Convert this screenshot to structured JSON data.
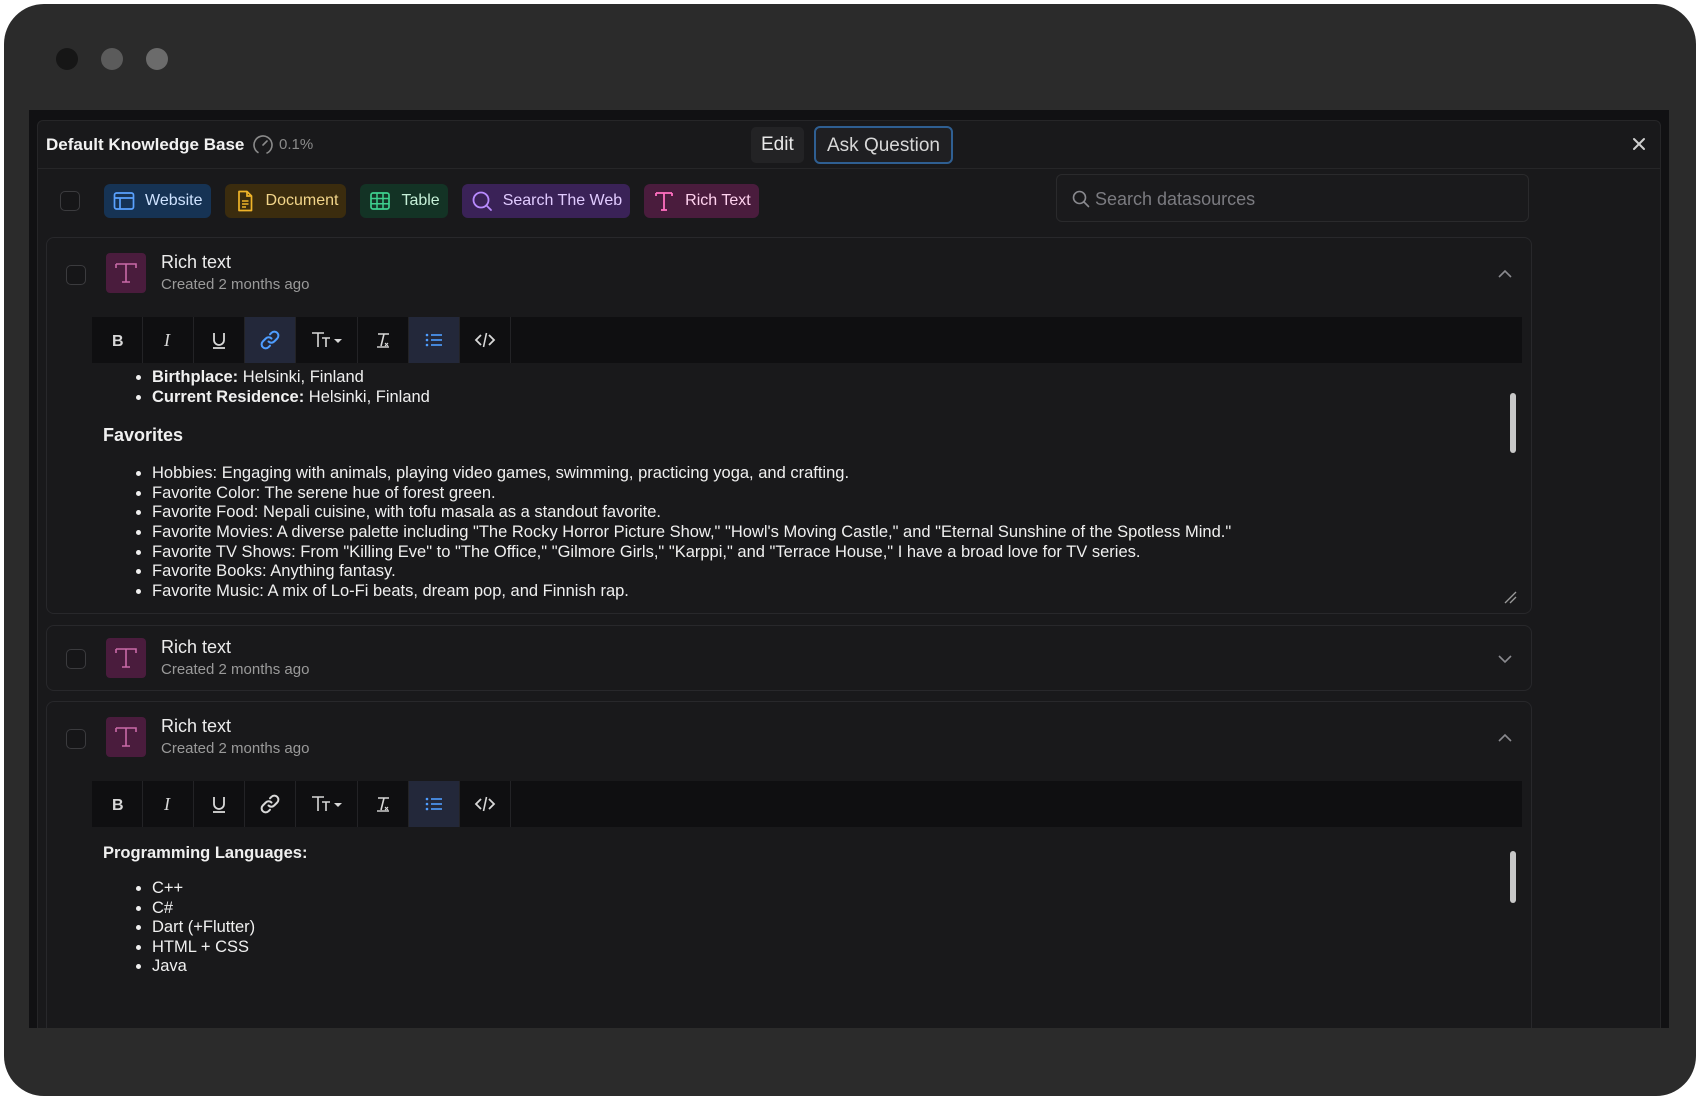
{
  "header": {
    "title": "Default Knowledge Base",
    "usage": "0.1%",
    "modes": {
      "edit": "Edit",
      "ask": "Ask Question"
    }
  },
  "filters": {
    "chips": [
      {
        "label": "Website",
        "icon": "browser-icon"
      },
      {
        "label": "Document",
        "icon": "document-icon"
      },
      {
        "label": "Table",
        "icon": "table-icon"
      },
      {
        "label": "Search The Web",
        "icon": "search-icon"
      },
      {
        "label": "Rich Text",
        "icon": "text-t-icon"
      }
    ],
    "search_placeholder": "Search datasources"
  },
  "sources": [
    {
      "title": "Rich text",
      "subtitle": "Created 2 months ago",
      "expanded": true,
      "content": {
        "top_items": [
          {
            "bold": "Birthplace:",
            "text": " Helsinki, Finland"
          },
          {
            "bold": "Current Residence:",
            "text": " Helsinki, Finland"
          }
        ],
        "heading": "Favorites",
        "items": [
          "Hobbies: Engaging with animals, playing video games, swimming, practicing yoga, and crafting.",
          "Favorite Color: The serene hue of forest green.",
          "Favorite Food: Nepali cuisine, with tofu masala as a standout favorite.",
          "Favorite Movies: A diverse palette including \"The Rocky Horror Picture Show,\" \"Howl's Moving Castle,\" and \"Eternal Sunshine of the Spotless Mind.\"",
          "Favorite TV Shows: From \"Killing Eve\" to \"The Office,\" \"Gilmore Girls,\" \"Karppi,\" and \"Terrace House,\" I have a broad love for TV series.",
          "Favorite Books: Anything fantasy.",
          "Favorite Music: A mix of Lo-Fi beats, dream pop, and Finnish rap."
        ]
      }
    },
    {
      "title": "Rich text",
      "subtitle": "Created 2 months ago",
      "expanded": false
    },
    {
      "title": "Rich text",
      "subtitle": "Created 2 months ago",
      "expanded": true,
      "content": {
        "heading": "Programming Languages:",
        "items": [
          "C++",
          "C#",
          "Dart (+Flutter)",
          "HTML + CSS",
          "Java"
        ]
      }
    }
  ],
  "toolbar_buttons": [
    "bold-icon",
    "italic-icon",
    "underline-icon",
    "link-icon",
    "text-size-icon",
    "clear-format-icon",
    "bullet-list-icon",
    "code-icon"
  ],
  "colors": {
    "accent_blue": "#2f5f92",
    "rich_text": "#4a1c3d",
    "website": "#163354",
    "document": "#3b2c0e",
    "table": "#133325",
    "search": "#3a2257"
  }
}
